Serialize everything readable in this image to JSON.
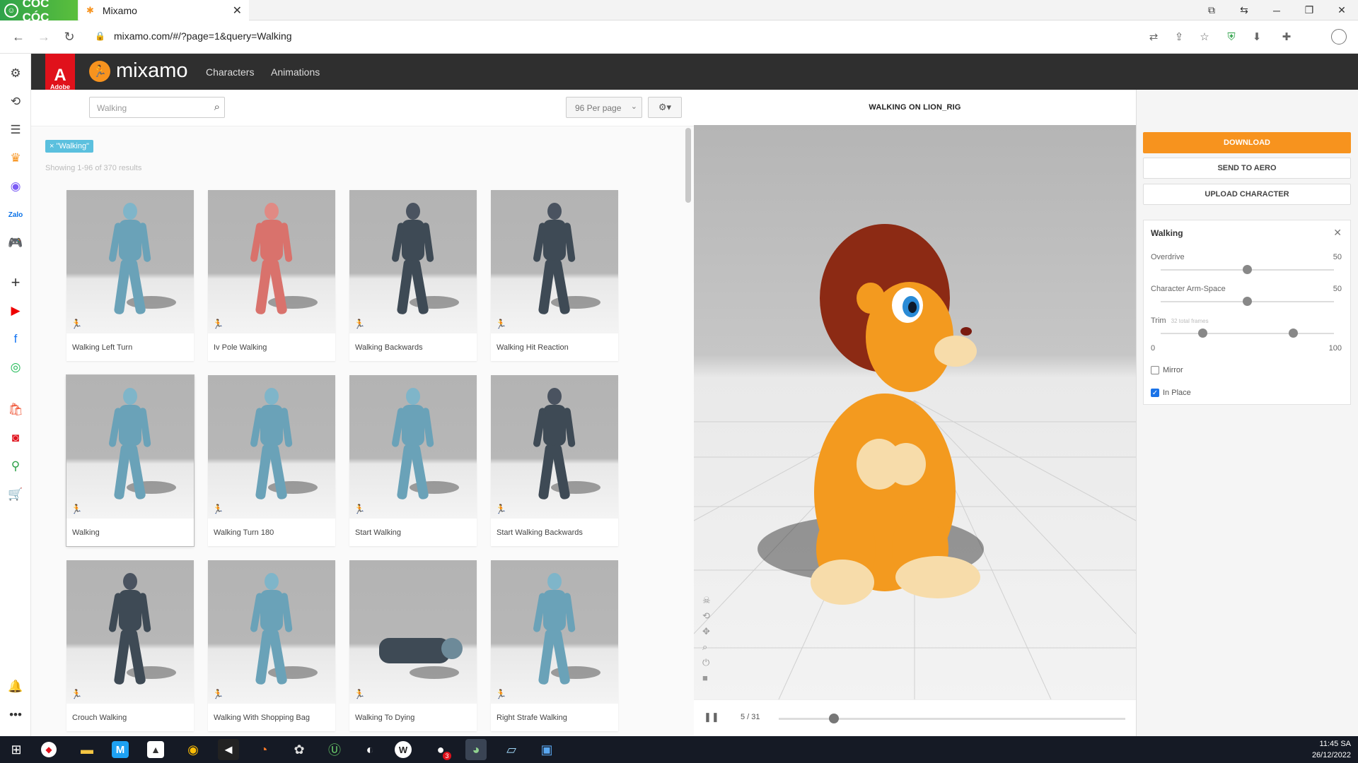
{
  "browser": {
    "brand": "CÓC CÓC",
    "tab_title": "Mixamo",
    "url": "mixamo.com/#/?page=1&query=Walking"
  },
  "mixamo": {
    "adobe_label": "Adobe",
    "logo": "mixamo",
    "nav": [
      "Characters",
      "Animations"
    ]
  },
  "toolbar": {
    "search_value": "Walking",
    "per_page": "96 Per page"
  },
  "results": {
    "chip": "× \"Walking\"",
    "count": "Showing 1-96 of 370 results",
    "cards": [
      {
        "label": "Walking Left Turn",
        "style": "blue"
      },
      {
        "label": "Iv Pole Walking",
        "style": "red"
      },
      {
        "label": "Walking Backwards",
        "style": "soldier"
      },
      {
        "label": "Walking Hit Reaction",
        "style": "soldier"
      },
      {
        "label": "Walking",
        "style": "blue",
        "selected": true
      },
      {
        "label": "Walking Turn 180",
        "style": "blue"
      },
      {
        "label": "Start Walking",
        "style": "blue"
      },
      {
        "label": "Start Walking Backwards",
        "style": "soldier"
      },
      {
        "label": "Crouch Walking",
        "style": "soldier"
      },
      {
        "label": "Walking With Shopping Bag",
        "style": "blue"
      },
      {
        "label": "Walking To Dying",
        "style": "soldier-down"
      },
      {
        "label": "Right Strafe Walking",
        "style": "blue"
      }
    ]
  },
  "viewer": {
    "title": "WALKING ON LION_RIG",
    "frame_current": "5",
    "frame_total": "31",
    "progress": 0.16
  },
  "panel": {
    "download": "DOWNLOAD",
    "send": "SEND TO AERO",
    "upload": "UPLOAD CHARACTER",
    "settings_title": "Walking",
    "overdrive_label": "Overdrive",
    "overdrive_value": "50",
    "armspace_label": "Character Arm-Space",
    "armspace_value": "50",
    "trim_label": "Trim",
    "trim_hint": "32 total frames",
    "trim_min": "0",
    "trim_max": "100",
    "mirror_label": "Mirror",
    "mirror_checked": false,
    "inplace_label": "In Place",
    "inplace_checked": true
  },
  "taskbar": {
    "time": "11:45 SA",
    "date": "26/12/2022",
    "badge": "3"
  },
  "colors": {
    "accent": "#f7931e",
    "header": "#2f2f2f",
    "adobe_red": "#e0111b",
    "chip": "#5bc0de"
  }
}
